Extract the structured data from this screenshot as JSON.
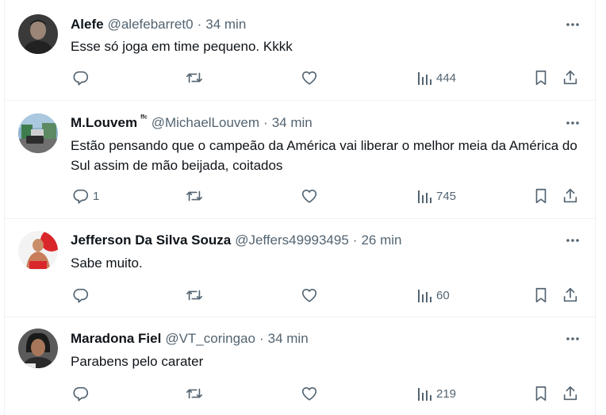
{
  "colors": {
    "text": "#0f1419",
    "secondary": "#536471",
    "divider": "#eff3f4"
  },
  "replies": [
    {
      "name": "Alefe",
      "badge": "",
      "handle": "@alefebarret0",
      "separator": "·",
      "time": "34 min",
      "text": "Esse só joga em time pequeno. Kkkk",
      "reply_count": "",
      "views": "444"
    },
    {
      "name": "M.Louvem",
      "badge": "ᶠᶠᶜ",
      "handle": "@MichaelLouvem",
      "separator": "·",
      "time": "34 min",
      "text": "Estão pensando que o campeão da América vai liberar o melhor meia da América do Sul assim de mão beijada, coitados",
      "reply_count": "1",
      "views": "745"
    },
    {
      "name": "Jefferson Da Silva Souza",
      "badge": "",
      "handle": "@Jeffers49993495",
      "separator": "·",
      "time": "26 min",
      "text": "Sabe muito.",
      "reply_count": "",
      "views": "60"
    },
    {
      "name": "Maradona Fiel",
      "badge": "",
      "handle": "@VT_coringao",
      "separator": "·",
      "time": "34 min",
      "text": "Parabens pelo carater",
      "reply_count": "",
      "views": "219"
    }
  ]
}
